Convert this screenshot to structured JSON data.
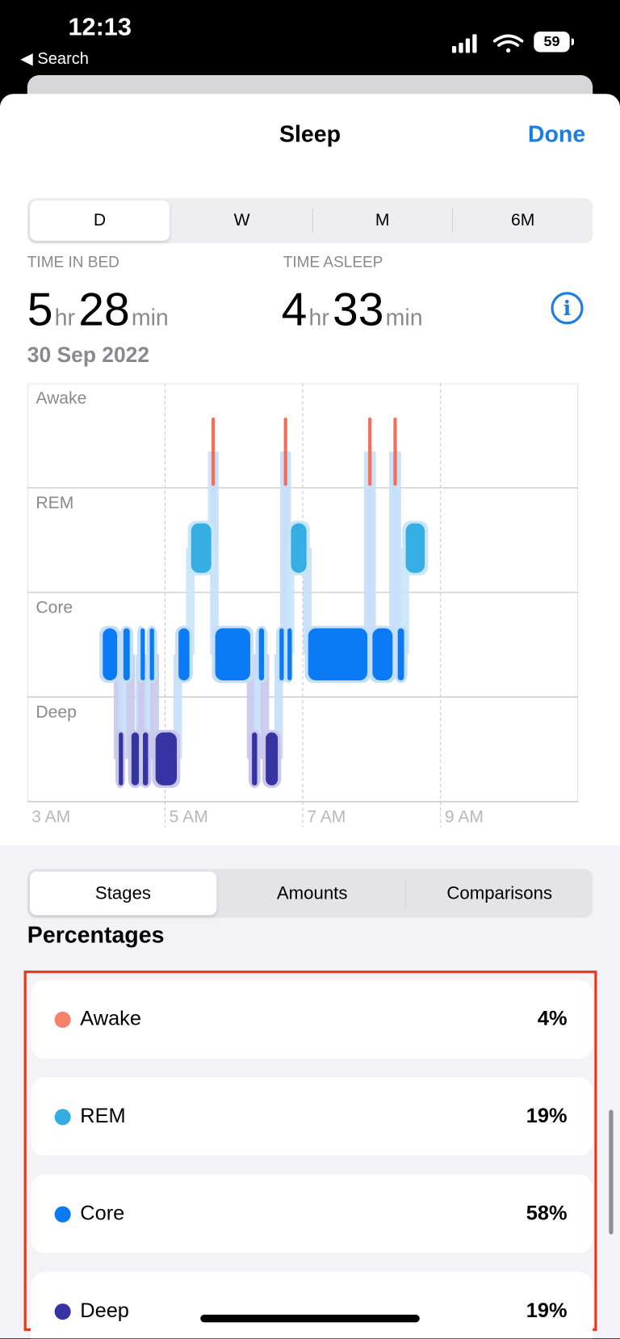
{
  "status_bar": {
    "time": "12:13",
    "back_label": "◀ Search",
    "battery": "59",
    "icons": [
      "cellular-signal-icon",
      "wifi-icon",
      "battery-icon"
    ]
  },
  "header": {
    "title": "Sleep",
    "done_label": "Done"
  },
  "range_tabs": [
    {
      "label": "D",
      "selected": true
    },
    {
      "label": "W"
    },
    {
      "label": "M"
    },
    {
      "label": "6M"
    }
  ],
  "summary": {
    "time_in_bed_label": "TIME IN BED",
    "bed_hr": "5",
    "bed_min": "28",
    "time_asleep_label": "TIME ASLEEP",
    "asleep_hr": "4",
    "asleep_min": "33",
    "hr_unit": "hr",
    "min_unit": "min",
    "date": "30 Sep 2022",
    "info_icon": "info-circle-icon"
  },
  "chart_data": {
    "type": "timeline",
    "stages": [
      "Awake",
      "REM",
      "Core",
      "Deep"
    ],
    "x_ticks": [
      "3 AM",
      "5 AM",
      "7 AM",
      "9 AM"
    ],
    "x_range": [
      "03:00",
      "11:00"
    ],
    "grid": true,
    "colors": {
      "Awake": "#f0705a",
      "REM": "#34aee3",
      "Core": "#0a7bf5",
      "Deep": "#3634a3"
    },
    "segments": [
      {
        "stage": "Core",
        "start": "04:05",
        "end": "04:19"
      },
      {
        "stage": "Deep",
        "start": "04:19",
        "end": "04:23"
      },
      {
        "stage": "Core",
        "start": "04:23",
        "end": "04:30"
      },
      {
        "stage": "Deep",
        "start": "04:30",
        "end": "04:38"
      },
      {
        "stage": "Core",
        "start": "04:38",
        "end": "04:40"
      },
      {
        "stage": "Deep",
        "start": "04:40",
        "end": "04:46"
      },
      {
        "stage": "Core",
        "start": "04:46",
        "end": "04:51"
      },
      {
        "stage": "Deep",
        "start": "04:51",
        "end": "05:11"
      },
      {
        "stage": "Core",
        "start": "05:11",
        "end": "05:22"
      },
      {
        "stage": "REM",
        "start": "05:22",
        "end": "05:41"
      },
      {
        "stage": "Awake",
        "start": "05:41",
        "end": "05:43"
      },
      {
        "stage": "Core",
        "start": "05:43",
        "end": "06:15"
      },
      {
        "stage": "Deep",
        "start": "06:15",
        "end": "06:21"
      },
      {
        "stage": "Core",
        "start": "06:21",
        "end": "06:27"
      },
      {
        "stage": "Deep",
        "start": "06:27",
        "end": "06:39"
      },
      {
        "stage": "Core",
        "start": "06:39",
        "end": "06:44"
      },
      {
        "stage": "Awake",
        "start": "06:44",
        "end": "06:46"
      },
      {
        "stage": "Core",
        "start": "06:46",
        "end": "06:49"
      },
      {
        "stage": "REM",
        "start": "06:49",
        "end": "07:04"
      },
      {
        "stage": "Core",
        "start": "07:04",
        "end": "07:57"
      },
      {
        "stage": "Awake",
        "start": "07:57",
        "end": "08:00"
      },
      {
        "stage": "Core",
        "start": "08:00",
        "end": "08:19"
      },
      {
        "stage": "Awake",
        "start": "08:19",
        "end": "08:22"
      },
      {
        "stage": "Core",
        "start": "08:22",
        "end": "08:29"
      },
      {
        "stage": "REM",
        "start": "08:29",
        "end": "08:47"
      }
    ]
  },
  "view_tabs": [
    {
      "label": "Stages",
      "selected": true
    },
    {
      "label": "Amounts"
    },
    {
      "label": "Comparisons"
    }
  ],
  "percentages": {
    "title": "Percentages",
    "items": [
      {
        "name": "Awake",
        "value": "4%",
        "color": "#f5836c"
      },
      {
        "name": "REM",
        "value": "19%",
        "color": "#36ade2"
      },
      {
        "name": "Core",
        "value": "58%",
        "color": "#0a7bf5"
      },
      {
        "name": "Deep",
        "value": "19%",
        "color": "#3634a3"
      }
    ]
  }
}
